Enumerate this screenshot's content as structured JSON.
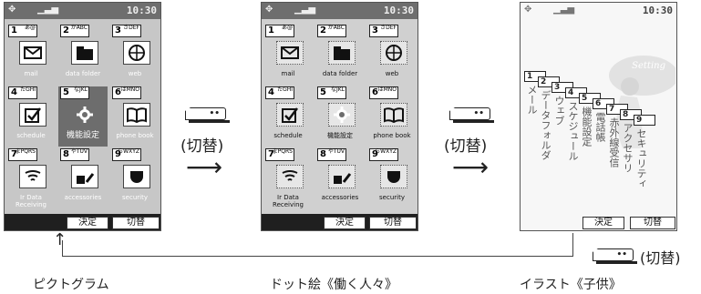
{
  "status": {
    "time": "10:30"
  },
  "screens": {
    "pictogram": {
      "cells": [
        {
          "num": "1",
          "kana": "あ@",
          "label": "mail"
        },
        {
          "num": "2",
          "kana": "かABC",
          "label": "data folder"
        },
        {
          "num": "3",
          "kana": "さDEF",
          "label": "web"
        },
        {
          "num": "4",
          "kana": "たGHI",
          "label": "schedule"
        },
        {
          "num": "5",
          "kana": "なJKL",
          "label": "機能設定"
        },
        {
          "num": "6",
          "kana": "はMNO",
          "label": "phone book"
        },
        {
          "num": "7",
          "kana": "まPQRS",
          "label": "Ir Data Receiving"
        },
        {
          "num": "8",
          "kana": "やTUV",
          "label": "accessories"
        },
        {
          "num": "9",
          "kana": "らWXYZ",
          "label": "security"
        }
      ],
      "soft_left": "決定",
      "soft_right": "切替"
    },
    "dot": {
      "cells": [
        {
          "num": "1",
          "kana": "あ@",
          "label": "mail"
        },
        {
          "num": "2",
          "kana": "かABC",
          "label": "data folder"
        },
        {
          "num": "3",
          "kana": "さDEF",
          "label": "web"
        },
        {
          "num": "4",
          "kana": "たGHI",
          "label": "schedule"
        },
        {
          "num": "5",
          "kana": "なJKL",
          "label": "機能設定"
        },
        {
          "num": "6",
          "kana": "はMNO",
          "label": "phone book"
        },
        {
          "num": "7",
          "kana": "まPQRS",
          "label": "Ir Data Receiving"
        },
        {
          "num": "8",
          "kana": "やTUV",
          "label": "accessories"
        },
        {
          "num": "9",
          "kana": "らWXYZ",
          "label": "security"
        }
      ],
      "soft_left": "決定",
      "soft_right": "切替"
    },
    "illust": {
      "setting_text": "Setting",
      "items": [
        "メール",
        "データフォルダ",
        "ウェブ",
        "スケジュール",
        "機能設定",
        "電話帳",
        "赤外線受信",
        "アクセサリ",
        "セキュリティ"
      ],
      "keys": [
        "1",
        "2",
        "3",
        "4",
        "5",
        "6",
        "7",
        "8",
        "9"
      ],
      "soft_left": "決定",
      "soft_right": "切替"
    }
  },
  "switch_label": "(切替)",
  "captions": {
    "pictogram": "ピクトグラム",
    "dot": "ドット絵《働く人々》",
    "illust": "イラスト《子供》"
  }
}
